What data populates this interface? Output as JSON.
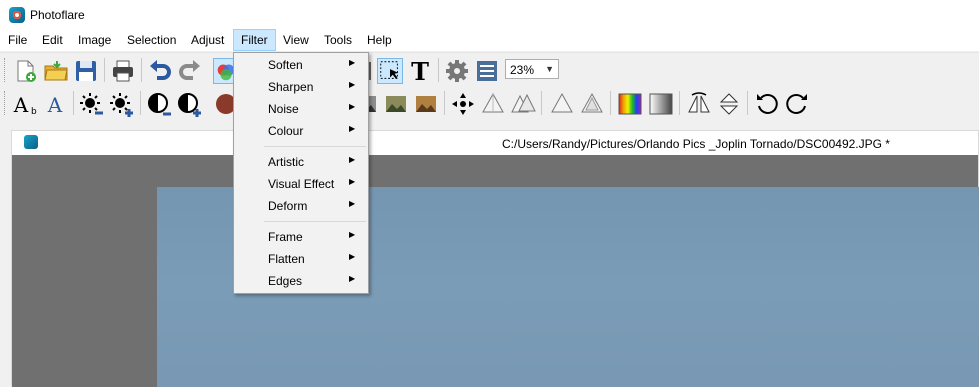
{
  "app": {
    "title": "Photoflare"
  },
  "menu": {
    "items": [
      {
        "label": "File"
      },
      {
        "label": "Edit"
      },
      {
        "label": "Image"
      },
      {
        "label": "Selection"
      },
      {
        "label": "Adjust"
      },
      {
        "label": "Filter"
      },
      {
        "label": "View"
      },
      {
        "label": "Tools"
      },
      {
        "label": "Help"
      }
    ],
    "active": "Filter"
  },
  "toolbar": {
    "zoom": {
      "value": "23%"
    },
    "text_tool_glyph": "T"
  },
  "document": {
    "path": "C:/Users/Randy/Pictures/Orlando Pics _Joplin Tornado/DSC00492.JPG *"
  },
  "filter_menu": {
    "groups": [
      [
        {
          "label": "Soften"
        },
        {
          "label": "Sharpen"
        },
        {
          "label": "Noise"
        },
        {
          "label": "Colour"
        }
      ],
      [
        {
          "label": "Artistic"
        },
        {
          "label": "Visual Effect"
        },
        {
          "label": "Deform"
        }
      ],
      [
        {
          "label": "Frame"
        },
        {
          "label": "Flatten"
        },
        {
          "label": "Edges"
        }
      ]
    ],
    "submenu_arrow": "▶"
  },
  "icons": {
    "toolbar1": [
      "new-file-icon",
      "open-folder-icon",
      "save-icon",
      "print-icon",
      "undo-icon",
      "redo-icon",
      "color-picker-icon",
      "selection-tool-icon",
      "text-tool-icon",
      "gear-icon",
      "layers-icon"
    ],
    "toolbar2": [
      "text-a-large-icon",
      "text-a-small-icon",
      "brightness-down-icon",
      "brightness-up-icon",
      "contrast-down-icon",
      "contrast-up-icon",
      "sphere-icon",
      "landscape-icon-1",
      "landscape-icon-2",
      "landscape-icon-3",
      "compass-icon",
      "prism-icon-1",
      "prism-icon-2",
      "prism-icon-3",
      "prism-icon-4",
      "gradient-rainbow-icon",
      "gradient-gray-icon",
      "flip-horizontal-icon",
      "flip-vertical-icon",
      "rotate-left-icon",
      "rotate-right-icon"
    ]
  },
  "colors": {
    "menu_highlight": "#cce8ff",
    "canvas_background": "#707070",
    "image_fill": "#7a9bb5"
  }
}
